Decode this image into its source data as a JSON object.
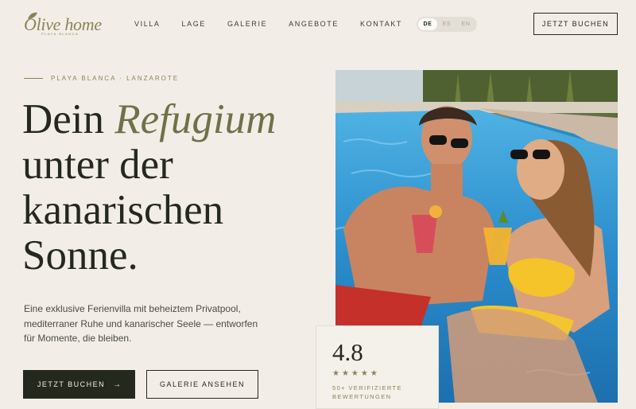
{
  "brand": {
    "name": "Olive home",
    "tagline": "PLAYA BLANCA"
  },
  "nav": {
    "items": [
      "VILLA",
      "LAGE",
      "GALERIE",
      "ANGEBOTE",
      "KONTAKT"
    ]
  },
  "language_switch": {
    "options": [
      "DE",
      "ES",
      "EN"
    ],
    "selected": "DE"
  },
  "header": {
    "book_label": "JETZT BUCHEN"
  },
  "hero": {
    "eyebrow": "PLAYA BLANCA · LANZAROTE",
    "headline_start": "Dein ",
    "headline_accent": "Refugium",
    "headline_line2": "unter der",
    "headline_line3": "kanarischen",
    "headline_line4": "Sonne.",
    "lead": "Eine exklusive Ferienvilla mit beheiztem Privatpool, mediterraner Ruhe und kanarischer Seele — entworfen für Momente, die bleiben.",
    "primary_button": "JETZT BUCHEN",
    "primary_arrow": "→",
    "secondary_button": "GALERIE ANSEHEN"
  },
  "rating": {
    "score": "4.8",
    "stars": "★★★★★",
    "stars_value": 5,
    "label": "50+ VERIFIZIERTE BEWERTUNGEN"
  },
  "colors": {
    "background": "#f2eee7",
    "text_dark": "#25291d",
    "olive_accent": "#8a8359",
    "pool_blue": "#2b8bc6"
  }
}
